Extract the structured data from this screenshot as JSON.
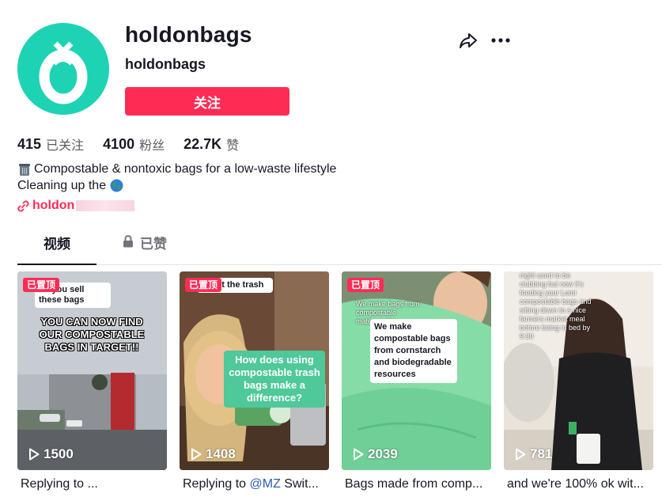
{
  "profile": {
    "username": "holdonbags",
    "nickname": "holdonbags",
    "follow_label": "关注",
    "following_count": "415",
    "following_label": "已关注",
    "followers_count": "4100",
    "followers_label": "粉丝",
    "likes_count": "22.7K",
    "likes_label": "赞",
    "bio_line1": "Compostable & nontoxic bags for a low-waste lifestyle",
    "bio_line2": "Cleaning up the",
    "link_text": "holdon",
    "avatar_color": "#1dd3b3"
  },
  "tabs": [
    {
      "label": "视频",
      "active": true
    },
    {
      "label": "已赞",
      "locked": true
    }
  ],
  "accent_color": "#fe2c55",
  "videos": [
    {
      "pinned_label": "已置顶",
      "plays": "1500",
      "caption": "Replying to ...",
      "reply_bubble": "do you sell these bags",
      "overlay_text": "YOU CAN NOW FIND OUR COMPOSTABLE BAGS IN TARGET!!"
    },
    {
      "pinned_label": "已置顶",
      "plays": "1408",
      "caption_prefix": "Replying to ",
      "caption_mention": "@MZ",
      "caption_suffix": " Swit...",
      "reply_bubble": "about the trash",
      "overlay_text": "How does using compostable trash bags make a difference?"
    },
    {
      "pinned_label": "已置顶",
      "plays": "2039",
      "caption": "Bags made from comp...",
      "small_text": "We make bags from compostable materials like",
      "overlay_text": "We make compostable bags from cornstarch and biodegradable resources"
    },
    {
      "plays": "781",
      "caption": "and we're 100% ok wit...",
      "overlay_text": "night used to be clubbing but now it's feeding your Lomi compostable bags and sitting down to a nice farmers market meal before being in bed by 9:30"
    }
  ]
}
